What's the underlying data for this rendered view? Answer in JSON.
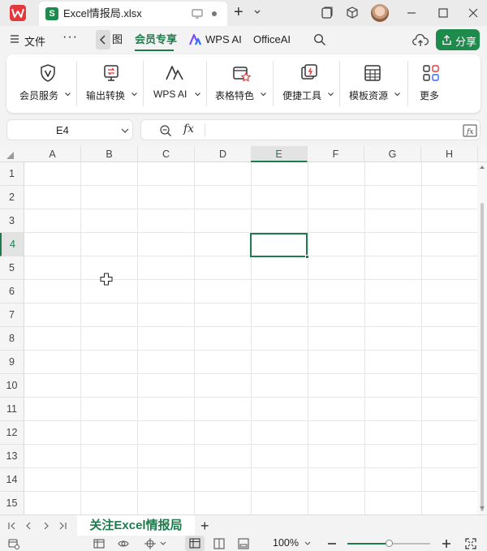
{
  "app": {
    "document_title": "Excel情报局.xlsx",
    "file_type_letter": "S",
    "new_tab_symbol": "+"
  },
  "menubar": {
    "file_label": "文件",
    "more_label": "···",
    "tabs": [
      {
        "label": "图"
      },
      {
        "label": "会员专享",
        "active": true
      },
      {
        "label": "WPS AI"
      },
      {
        "label": "OfficeAI"
      }
    ],
    "share_label": "分享"
  },
  "ribbon": {
    "items": [
      {
        "label": "会员服务",
        "icon": "vip-shield-icon"
      },
      {
        "label": "输出转换",
        "icon": "export-convert-icon"
      },
      {
        "label": "WPS AI",
        "icon": "wps-ai-icon"
      },
      {
        "label": "表格特色",
        "icon": "table-feature-icon"
      },
      {
        "label": "便捷工具",
        "icon": "toolbox-icon"
      },
      {
        "label": "模板资源",
        "icon": "template-icon"
      },
      {
        "label": "更多",
        "icon": "more-apps-icon"
      }
    ]
  },
  "formula_bar": {
    "name_box": "E4",
    "fx_label": "fx",
    "formula_value": ""
  },
  "grid": {
    "columns": [
      "A",
      "B",
      "C",
      "D",
      "E",
      "F",
      "G",
      "H"
    ],
    "rows": [
      "1",
      "2",
      "3",
      "4",
      "5",
      "6",
      "7",
      "8",
      "9",
      "10",
      "11",
      "12",
      "13",
      "14",
      "15"
    ],
    "active_column": "E",
    "active_row": "4"
  },
  "sheets": {
    "tabs": [
      {
        "label": "关注Excel情报局",
        "active": true
      }
    ],
    "add_symbol": "+"
  },
  "status": {
    "zoom_label": "100%",
    "zoom_fraction": 0.5
  },
  "colors": {
    "accent": "#1f7b4d",
    "share_button": "#1e8b4c",
    "wps_logo": "#e4393c"
  }
}
